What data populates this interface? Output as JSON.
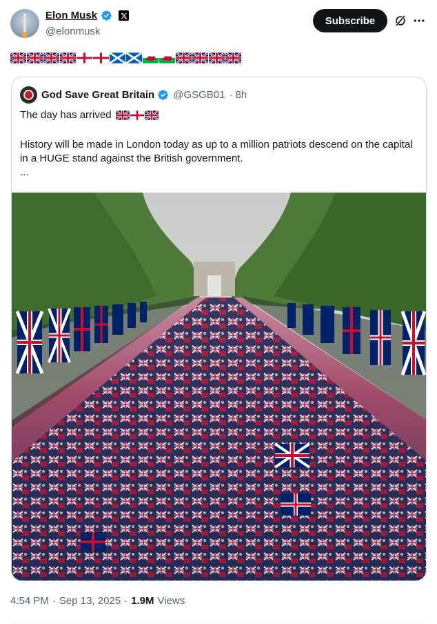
{
  "author": {
    "name": "Elon Musk",
    "handle": "@elonmusk"
  },
  "actions": {
    "subscribe_label": "Subscribe"
  },
  "tweet": {
    "flags": [
      "uk",
      "uk",
      "uk",
      "uk",
      "england",
      "england",
      "scotland",
      "scotland",
      "wales",
      "wales",
      "uk",
      "uk",
      "uk",
      "uk"
    ]
  },
  "quoted": {
    "name": "God Save Great Britain",
    "handle": "@GSGB01",
    "sep": "·",
    "time": "8h",
    "line1": "The day has arrived",
    "line1_flags": [
      "uk",
      "england",
      "uk"
    ],
    "line2": "History will be made in London today as up to a million patriots descend on the capital in a HUGE stand against the British government.",
    "line3": "..."
  },
  "meta": {
    "time": "4:54 PM",
    "sep1": "·",
    "date": "Sep 13, 2025",
    "sep2": "·",
    "views": "1.9M",
    "views_label": "Views"
  },
  "colors": {
    "accent": "#1d9bf0",
    "text": "#0f1419",
    "muted": "#536471",
    "union_blue": "#012169",
    "union_red": "#C8102E"
  }
}
